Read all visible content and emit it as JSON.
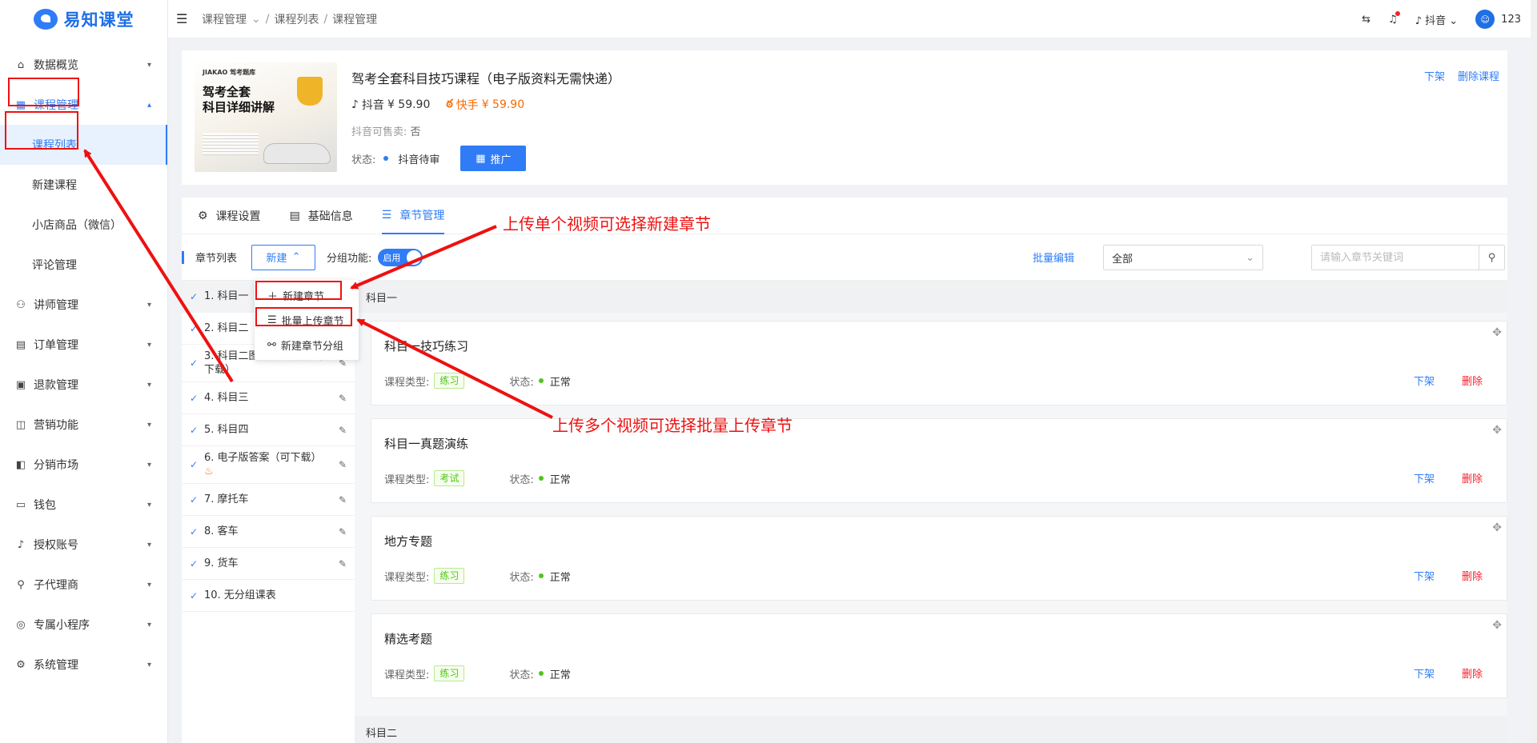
{
  "brand": {
    "name": "易知课堂"
  },
  "sidebar": {
    "items": [
      {
        "label": "数据概览",
        "icon": "home-icon"
      },
      {
        "label": "课程管理",
        "icon": "grid-icon",
        "open": true,
        "children": [
          "课程列表",
          "新建课程",
          "小店商品（微信）",
          "评论管理"
        ]
      },
      {
        "label": "讲师管理",
        "icon": "users-icon"
      },
      {
        "label": "订单管理",
        "icon": "order-icon"
      },
      {
        "label": "退款管理",
        "icon": "refund-icon"
      },
      {
        "label": "营销功能",
        "icon": "bag-icon"
      },
      {
        "label": "分销市场",
        "icon": "market-icon"
      },
      {
        "label": "钱包",
        "icon": "wallet-icon"
      },
      {
        "label": "授权账号",
        "icon": "douyin-icon"
      },
      {
        "label": "子代理商",
        "icon": "agent-icon"
      },
      {
        "label": "专属小程序",
        "icon": "miniapp-icon"
      },
      {
        "label": "系统管理",
        "icon": "gear-icon"
      }
    ]
  },
  "topbar": {
    "breadcrumb": [
      "课程管理",
      "课程列表",
      "课程管理"
    ],
    "platform": "抖音",
    "user": "123"
  },
  "course": {
    "thumb_brand": "JIAKAO 驾考题库",
    "thumb_title_1": "驾考全套",
    "thumb_title_2": "科目详细讲解",
    "title": "驾考全套科目技巧课程（电子版资料无需快递）",
    "douyin_label": "抖音",
    "douyin_price": "¥ 59.90",
    "kuaishou_label": "快手",
    "kuaishou_price": "¥ 59.90",
    "saleable_label": "抖音可售卖:",
    "saleable_value": "否",
    "status_label": "状态:",
    "status_value": "抖音待审",
    "promote_label": "推广",
    "action_offshelf": "下架",
    "action_delete": "删除课程"
  },
  "tabs": [
    {
      "label": "课程设置",
      "icon": "gear-icon"
    },
    {
      "label": "基础信息",
      "icon": "doc-icon"
    },
    {
      "label": "章节管理",
      "icon": "list-icon",
      "active": true
    }
  ],
  "toolbar": {
    "section_label": "章节列表",
    "new_label": "新建",
    "group_label": "分组功能:",
    "toggle_label": "启用",
    "batch_edit": "批量编辑",
    "select_value": "全部",
    "search_placeholder": "请输入章节关键词"
  },
  "dropdown": {
    "new_chapter": "新建章节",
    "batch_upload": "批量上传章节",
    "new_group": "新建章节分组"
  },
  "chapters": [
    "1. 科目一",
    "2. 科目二",
    "3. 科目二图文点位讲解（可下载）",
    "4. 科目三",
    "5. 科目四",
    "6. 电子版答案（可下载）",
    "7. 摩托车",
    "8. 客车",
    "9. 货车",
    "10. 无分组课表"
  ],
  "groups": {
    "current": "科目一",
    "next": "科目二"
  },
  "lesson_labels": {
    "type": "课程类型:",
    "state": "状态:",
    "offshelf": "下架",
    "delete": "删除"
  },
  "lessons": [
    {
      "title": "科目一技巧练习",
      "type": "练习",
      "state": "正常"
    },
    {
      "title": "科目一真题演练",
      "type": "考试",
      "state": "正常"
    },
    {
      "title": "地方专题",
      "type": "练习",
      "state": "正常"
    },
    {
      "title": "精选考题",
      "type": "练习",
      "state": "正常"
    }
  ],
  "annotations": {
    "single": "上传单个视频可选择新建章节",
    "multi": "上传多个视频可选择批量上传章节"
  },
  "colors": {
    "primary": "#2f7cf6",
    "danger": "#f5222d",
    "success": "#52c41a",
    "annotation": "#ee1111",
    "kuaishou": "#f56a00"
  }
}
